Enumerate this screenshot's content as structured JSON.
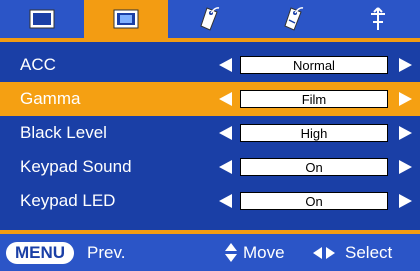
{
  "tabs": [
    {
      "icon": "picture-icon",
      "active": false
    },
    {
      "icon": "screen-icon",
      "active": true
    },
    {
      "icon": "tag-icon",
      "active": false
    },
    {
      "icon": "tag-settings-icon",
      "active": false
    },
    {
      "icon": "network-icon",
      "active": false
    }
  ],
  "menu": {
    "items": [
      {
        "label": "ACC",
        "value": "Normal",
        "selected": false
      },
      {
        "label": "Gamma",
        "value": "Film",
        "selected": true
      },
      {
        "label": "Black Level",
        "value": "High",
        "selected": false
      },
      {
        "label": "Keypad Sound",
        "value": "On",
        "selected": false
      },
      {
        "label": "Keypad LED",
        "value": "On",
        "selected": false
      }
    ]
  },
  "footer": {
    "menu_label": "MENU",
    "prev_label": "Prev.",
    "move_label": "Move",
    "select_label": "Select"
  },
  "colors": {
    "background": "#1a3fa6",
    "bar": "#2b55c7",
    "accent": "#f5a012"
  }
}
